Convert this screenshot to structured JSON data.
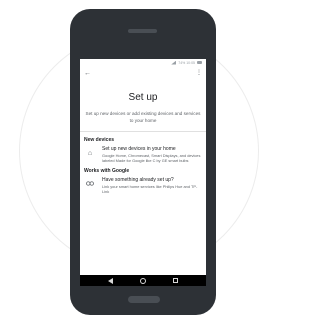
{
  "status_bar": {
    "text": "74% 10:05"
  },
  "screen": {
    "title": "Set up",
    "subtitle": "Set up new devices or add existing devices and services to your home"
  },
  "sections": [
    {
      "header": "New devices",
      "item": {
        "icon": "home-icon",
        "title": "Set up new devices in your home",
        "description": "Google Home, Chromecast, Smart Displays, and devices labeled Made for Google like C by GE smart bulbs"
      }
    },
    {
      "header": "Works with Google",
      "item": {
        "icon": "link-icon",
        "title": "Have something already set up?",
        "description": "Link your smart home services like Philips Hue and TP-Link"
      }
    }
  ]
}
